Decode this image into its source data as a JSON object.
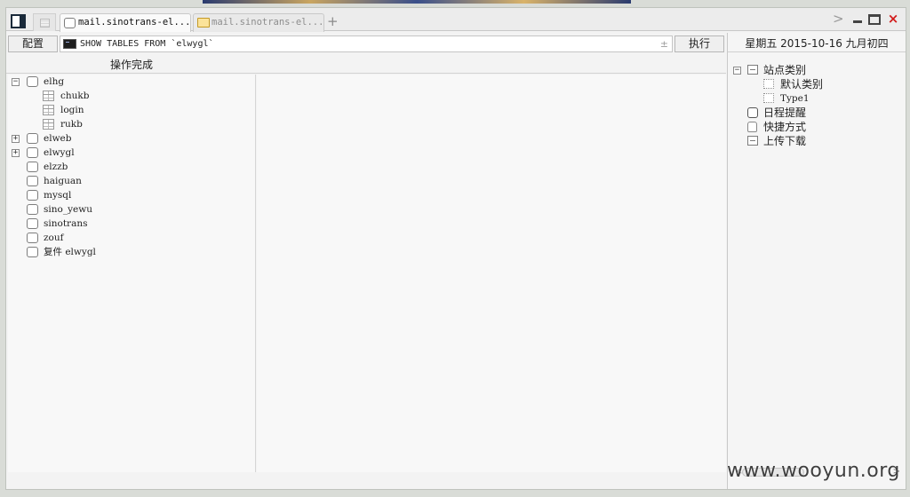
{
  "tabs": {
    "active_label": "mail.sinotrans-el...",
    "inactive_label": "mail.sinotrans-el...",
    "add_label": "+",
    "overflow_label": ">",
    "close_label": "×"
  },
  "toolbar": {
    "config_label": "配置",
    "query_value": "SHOW TABLES FROM `elwygl`",
    "plusminus_label": "±",
    "execute_label": "执行"
  },
  "status": {
    "message": "操作完成"
  },
  "tree": {
    "nodes": [
      {
        "label": "elhg",
        "expander": "−",
        "type": "database"
      },
      {
        "label": "chukb",
        "type": "table"
      },
      {
        "label": "login",
        "type": "table"
      },
      {
        "label": "rukb",
        "type": "table"
      },
      {
        "label": "elweb",
        "expander": "+",
        "type": "database"
      },
      {
        "label": "elwygl",
        "expander": "+",
        "type": "database"
      },
      {
        "label": "elzzb",
        "type": "database"
      },
      {
        "label": "haiguan",
        "type": "database"
      },
      {
        "label": "mysql",
        "type": "database"
      },
      {
        "label": "sino_yewu",
        "type": "database"
      },
      {
        "label": "sinotrans",
        "type": "database"
      },
      {
        "label": "zouf",
        "type": "database"
      },
      {
        "label": "复件 elwygl",
        "type": "database"
      }
    ]
  },
  "right_panel": {
    "date": "星期五 2015-10-16 九月初四",
    "site_category": {
      "label": "站点类别",
      "expander": "−"
    },
    "site_children": [
      {
        "label": "默认类别"
      },
      {
        "label": "Type1"
      }
    ],
    "schedule": "日程提醒",
    "shortcuts": "快捷方式",
    "upload_download": "上传下载",
    "scroll_left": "<",
    "scroll_right": ">"
  },
  "watermark": "www.wooyun.org"
}
